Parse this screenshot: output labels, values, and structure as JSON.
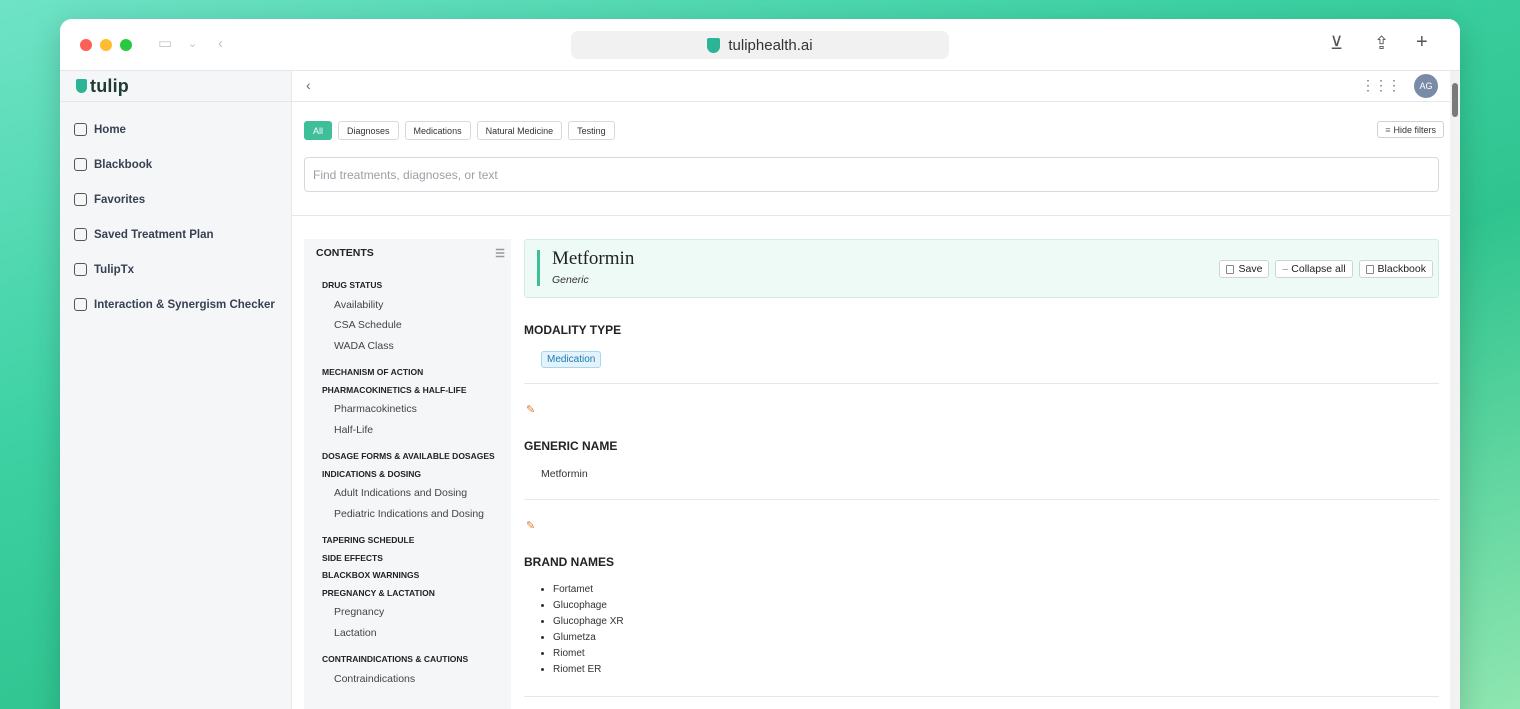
{
  "browser": {
    "url": "tuliphealth.ai"
  },
  "app": {
    "brand": "tulip",
    "avatar_initials": "AG"
  },
  "sidebar": {
    "items": [
      {
        "label": "Home",
        "icon": "home-icon"
      },
      {
        "label": "Blackbook",
        "icon": "book-icon"
      },
      {
        "label": "Favorites",
        "icon": "folder-icon"
      },
      {
        "label": "Saved Treatment Plan",
        "icon": "download-box-icon"
      },
      {
        "label": "TulipTx",
        "icon": "document-icon"
      },
      {
        "label": "Interaction & Synergism Checker",
        "icon": "checklist-icon"
      }
    ]
  },
  "filters": {
    "chips": [
      "All",
      "Diagnoses",
      "Medications",
      "Natural Medicine",
      "Testing"
    ],
    "active": "All",
    "hide_label": "Hide filters"
  },
  "search": {
    "placeholder": "Find treatments, diagnoses, or text",
    "value": ""
  },
  "toc": {
    "title": "CONTENTS",
    "sections": [
      {
        "label": "DRUG STATUS",
        "subs": [
          "Availability",
          "CSA Schedule",
          "WADA Class"
        ]
      },
      {
        "label": "MECHANISM OF ACTION",
        "subs": []
      },
      {
        "label": "PHARMACOKINETICS & HALF-LIFE",
        "subs": [
          "Pharmacokinetics",
          "Half-Life"
        ]
      },
      {
        "label": "DOSAGE FORMS & AVAILABLE DOSAGES",
        "subs": []
      },
      {
        "label": "INDICATIONS & DOSING",
        "subs": [
          "Adult Indications and Dosing",
          "Pediatric Indications and Dosing"
        ]
      },
      {
        "label": "TAPERING SCHEDULE",
        "subs": []
      },
      {
        "label": "SIDE EFFECTS",
        "subs": []
      },
      {
        "label": "BLACKBOX WARNINGS",
        "subs": []
      },
      {
        "label": "PREGNANCY & LACTATION",
        "subs": [
          "Pregnancy",
          "Lactation"
        ]
      },
      {
        "label": "CONTRAINDICATIONS & CAUTIONS",
        "subs": [
          "Contraindications"
        ]
      }
    ]
  },
  "drug": {
    "name": "Metformin",
    "subtitle": "Generic",
    "buttons": {
      "save": "Save",
      "collapse": "Collapse all",
      "blackbook": "Blackbook"
    },
    "modality_title": "MODALITY TYPE",
    "modality_tag": "Medication",
    "generic_title": "GENERIC NAME",
    "generic_value": "Metformin",
    "brand_title": "BRAND NAMES",
    "brand_names": [
      "Fortamet",
      "Glucophage",
      "Glucophage XR",
      "Glumetza",
      "Riomet",
      "Riomet ER"
    ]
  },
  "colors": {
    "accent": "#3ebf9a",
    "tag_blue": "#1a7ab5",
    "pencil": "#e07b2c"
  }
}
